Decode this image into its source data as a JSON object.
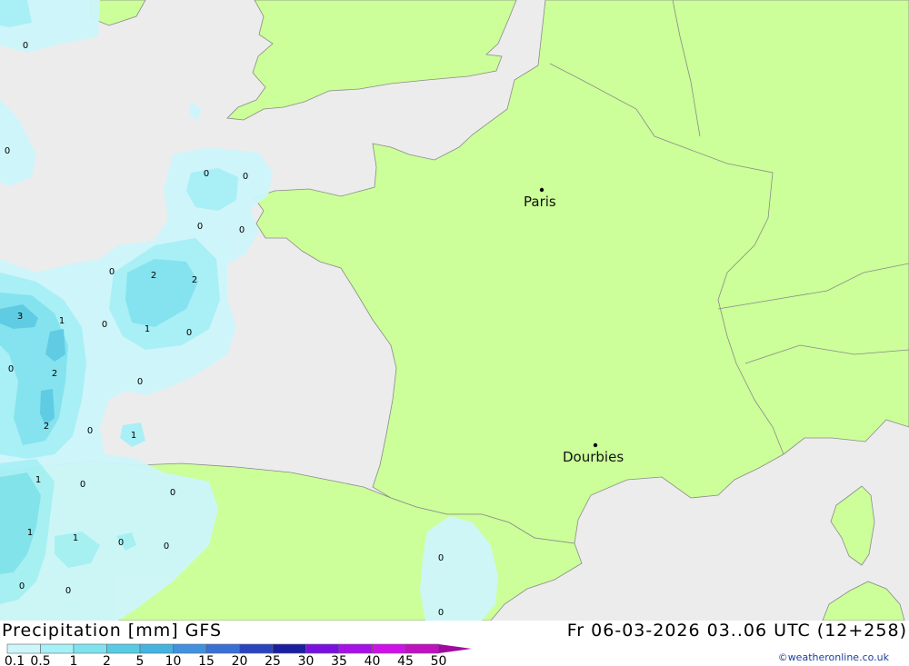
{
  "header": {
    "title_left": "Precipitation [mm] GFS",
    "title_right": "Fr 06-03-2026 03..06 UTC (12+258)",
    "credit": "©weatheronline.co.uk"
  },
  "cities": [
    {
      "name": "Paris"
    },
    {
      "name": "Dourbies"
    }
  ],
  "legend": {
    "labels": [
      "0.1",
      "0.5",
      "1",
      "2",
      "5",
      "10",
      "15",
      "20",
      "25",
      "30",
      "35",
      "40",
      "45",
      "50"
    ],
    "colors": [
      "#cdf6fb",
      "#a6f0f7",
      "#7fe3ef",
      "#58cbe4",
      "#45b3e0",
      "#4191e0",
      "#3a6fd6",
      "#2a44c0",
      "#1a1fa0",
      "#7a10e0",
      "#a810e8",
      "#d010e8",
      "#c010c0",
      "#a00aa0"
    ]
  },
  "values": [
    "0",
    "0",
    "0",
    "0",
    "0",
    "0",
    "2",
    "2",
    "0",
    "3",
    "1",
    "0",
    "1",
    "0",
    "0",
    "2",
    "0",
    "2",
    "0",
    "1",
    "1",
    "0",
    "0",
    "1",
    "1",
    "0",
    "0",
    "0",
    "0",
    "0",
    "0"
  ],
  "colors": {
    "sea": "#ececec",
    "land": "#ccff99",
    "border": "#8a8a8a"
  }
}
